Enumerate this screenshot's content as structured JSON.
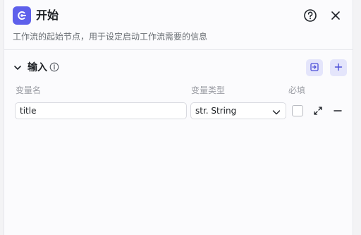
{
  "header": {
    "title": "开始",
    "description": "工作流的起始节点，用于设定启动工作流需要的信息"
  },
  "input_section": {
    "label": "输入",
    "columns": {
      "name": "变量名",
      "type": "变量类型",
      "required": "必填"
    },
    "rows": [
      {
        "name": "title",
        "type": "str. String",
        "required": false
      }
    ]
  },
  "colors": {
    "accent": "#5e60eb",
    "button_bg": "#e4e5fb"
  },
  "icons": [
    "start-node-icon",
    "help-icon",
    "close-icon",
    "chevron-down-icon",
    "info-icon",
    "import-icon",
    "plus-icon",
    "expand-icon",
    "minus-icon"
  ]
}
